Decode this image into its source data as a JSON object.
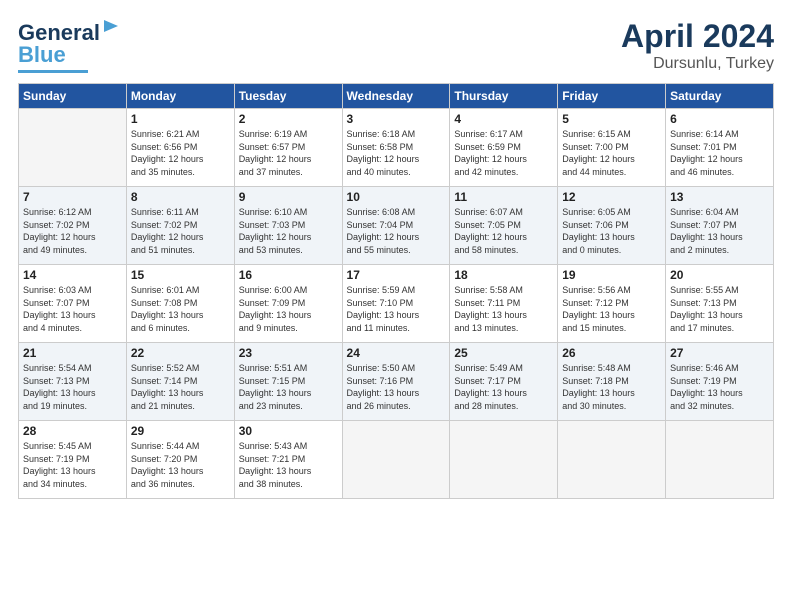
{
  "header": {
    "logo_line1": "General",
    "logo_line2": "Blue",
    "month": "April 2024",
    "location": "Dursunlu, Turkey"
  },
  "weekdays": [
    "Sunday",
    "Monday",
    "Tuesday",
    "Wednesday",
    "Thursday",
    "Friday",
    "Saturday"
  ],
  "weeks": [
    [
      {
        "day": "",
        "info": ""
      },
      {
        "day": "1",
        "info": "Sunrise: 6:21 AM\nSunset: 6:56 PM\nDaylight: 12 hours\nand 35 minutes."
      },
      {
        "day": "2",
        "info": "Sunrise: 6:19 AM\nSunset: 6:57 PM\nDaylight: 12 hours\nand 37 minutes."
      },
      {
        "day": "3",
        "info": "Sunrise: 6:18 AM\nSunset: 6:58 PM\nDaylight: 12 hours\nand 40 minutes."
      },
      {
        "day": "4",
        "info": "Sunrise: 6:17 AM\nSunset: 6:59 PM\nDaylight: 12 hours\nand 42 minutes."
      },
      {
        "day": "5",
        "info": "Sunrise: 6:15 AM\nSunset: 7:00 PM\nDaylight: 12 hours\nand 44 minutes."
      },
      {
        "day": "6",
        "info": "Sunrise: 6:14 AM\nSunset: 7:01 PM\nDaylight: 12 hours\nand 46 minutes."
      }
    ],
    [
      {
        "day": "7",
        "info": "Sunrise: 6:12 AM\nSunset: 7:02 PM\nDaylight: 12 hours\nand 49 minutes."
      },
      {
        "day": "8",
        "info": "Sunrise: 6:11 AM\nSunset: 7:02 PM\nDaylight: 12 hours\nand 51 minutes."
      },
      {
        "day": "9",
        "info": "Sunrise: 6:10 AM\nSunset: 7:03 PM\nDaylight: 12 hours\nand 53 minutes."
      },
      {
        "day": "10",
        "info": "Sunrise: 6:08 AM\nSunset: 7:04 PM\nDaylight: 12 hours\nand 55 minutes."
      },
      {
        "day": "11",
        "info": "Sunrise: 6:07 AM\nSunset: 7:05 PM\nDaylight: 12 hours\nand 58 minutes."
      },
      {
        "day": "12",
        "info": "Sunrise: 6:05 AM\nSunset: 7:06 PM\nDaylight: 13 hours\nand 0 minutes."
      },
      {
        "day": "13",
        "info": "Sunrise: 6:04 AM\nSunset: 7:07 PM\nDaylight: 13 hours\nand 2 minutes."
      }
    ],
    [
      {
        "day": "14",
        "info": "Sunrise: 6:03 AM\nSunset: 7:07 PM\nDaylight: 13 hours\nand 4 minutes."
      },
      {
        "day": "15",
        "info": "Sunrise: 6:01 AM\nSunset: 7:08 PM\nDaylight: 13 hours\nand 6 minutes."
      },
      {
        "day": "16",
        "info": "Sunrise: 6:00 AM\nSunset: 7:09 PM\nDaylight: 13 hours\nand 9 minutes."
      },
      {
        "day": "17",
        "info": "Sunrise: 5:59 AM\nSunset: 7:10 PM\nDaylight: 13 hours\nand 11 minutes."
      },
      {
        "day": "18",
        "info": "Sunrise: 5:58 AM\nSunset: 7:11 PM\nDaylight: 13 hours\nand 13 minutes."
      },
      {
        "day": "19",
        "info": "Sunrise: 5:56 AM\nSunset: 7:12 PM\nDaylight: 13 hours\nand 15 minutes."
      },
      {
        "day": "20",
        "info": "Sunrise: 5:55 AM\nSunset: 7:13 PM\nDaylight: 13 hours\nand 17 minutes."
      }
    ],
    [
      {
        "day": "21",
        "info": "Sunrise: 5:54 AM\nSunset: 7:13 PM\nDaylight: 13 hours\nand 19 minutes."
      },
      {
        "day": "22",
        "info": "Sunrise: 5:52 AM\nSunset: 7:14 PM\nDaylight: 13 hours\nand 21 minutes."
      },
      {
        "day": "23",
        "info": "Sunrise: 5:51 AM\nSunset: 7:15 PM\nDaylight: 13 hours\nand 23 minutes."
      },
      {
        "day": "24",
        "info": "Sunrise: 5:50 AM\nSunset: 7:16 PM\nDaylight: 13 hours\nand 26 minutes."
      },
      {
        "day": "25",
        "info": "Sunrise: 5:49 AM\nSunset: 7:17 PM\nDaylight: 13 hours\nand 28 minutes."
      },
      {
        "day": "26",
        "info": "Sunrise: 5:48 AM\nSunset: 7:18 PM\nDaylight: 13 hours\nand 30 minutes."
      },
      {
        "day": "27",
        "info": "Sunrise: 5:46 AM\nSunset: 7:19 PM\nDaylight: 13 hours\nand 32 minutes."
      }
    ],
    [
      {
        "day": "28",
        "info": "Sunrise: 5:45 AM\nSunset: 7:19 PM\nDaylight: 13 hours\nand 34 minutes."
      },
      {
        "day": "29",
        "info": "Sunrise: 5:44 AM\nSunset: 7:20 PM\nDaylight: 13 hours\nand 36 minutes."
      },
      {
        "day": "30",
        "info": "Sunrise: 5:43 AM\nSunset: 7:21 PM\nDaylight: 13 hours\nand 38 minutes."
      },
      {
        "day": "",
        "info": ""
      },
      {
        "day": "",
        "info": ""
      },
      {
        "day": "",
        "info": ""
      },
      {
        "day": "",
        "info": ""
      }
    ]
  ]
}
